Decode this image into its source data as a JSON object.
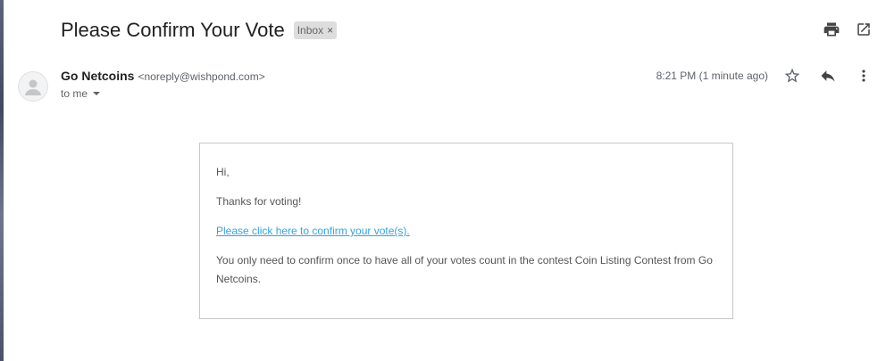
{
  "email": {
    "subject": "Please Confirm Your Vote",
    "label": "Inbox",
    "label_remove": "×",
    "sender_name": "Go Netcoins",
    "sender_email": "<noreply@wishpond.com>",
    "to_line": "to me",
    "timestamp": "8:21 PM (1 minute ago)"
  },
  "body": {
    "greeting": "Hi,",
    "thanks": "Thanks for voting!",
    "confirm_link": "Please click here to confirm your vote(s).",
    "note": "You only need to confirm once to have all of your votes count in the contest Coin Listing Contest from Go Netcoins."
  },
  "icons": {
    "print": "print-icon",
    "open_new_window": "open-in-new-window-icon",
    "star": "star-icon",
    "reply": "reply-icon",
    "more": "more-vert-icon",
    "avatar": "person-icon"
  },
  "colors": {
    "link": "#3aa3d6",
    "label_bg": "#dddddd",
    "icon": "#5f6368"
  }
}
